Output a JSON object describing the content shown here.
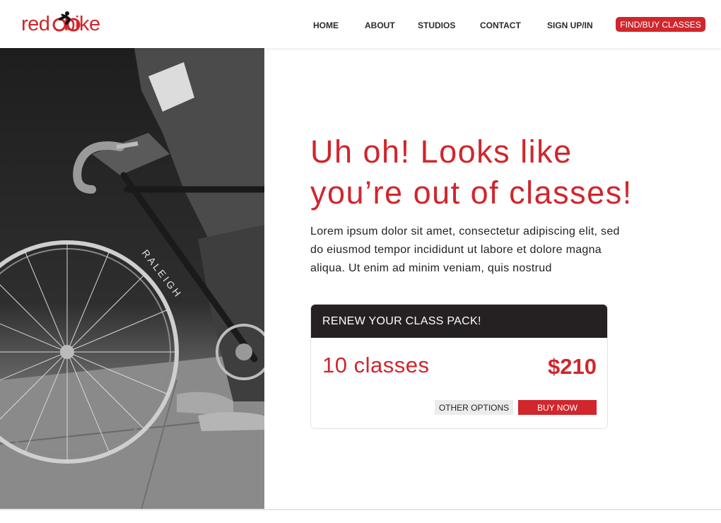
{
  "brand": {
    "logo_text_left": "red",
    "logo_text_right": "bike",
    "accent": "#d0262c",
    "dark": "#252122"
  },
  "nav": {
    "items": [
      {
        "label": "HOME"
      },
      {
        "label": "ABOUT"
      },
      {
        "label": "STUDIOS"
      },
      {
        "label": "CONTACT"
      },
      {
        "label": "SIGN UP/IN"
      }
    ],
    "cta_label": "FIND/BUY CLASSES"
  },
  "hero": {
    "image": "cyclist-with-bicycle-photo",
    "headline_line1": "Uh oh! Looks like",
    "headline_line2": "you’re out of classes!",
    "body": "Lorem ipsum dolor sit amet, consectetur adipiscing elit, sed do eiusmod tempor incididunt ut labore et dolore magna aliqua. Ut enim ad minim veniam, quis nostrud"
  },
  "renew_card": {
    "title": "RENEW YOUR CLASS PACK!",
    "quantity": "10 classes",
    "price": "$210",
    "other_options_label": "OTHER OPTIONS",
    "buy_now_label": "BUY NOW"
  }
}
